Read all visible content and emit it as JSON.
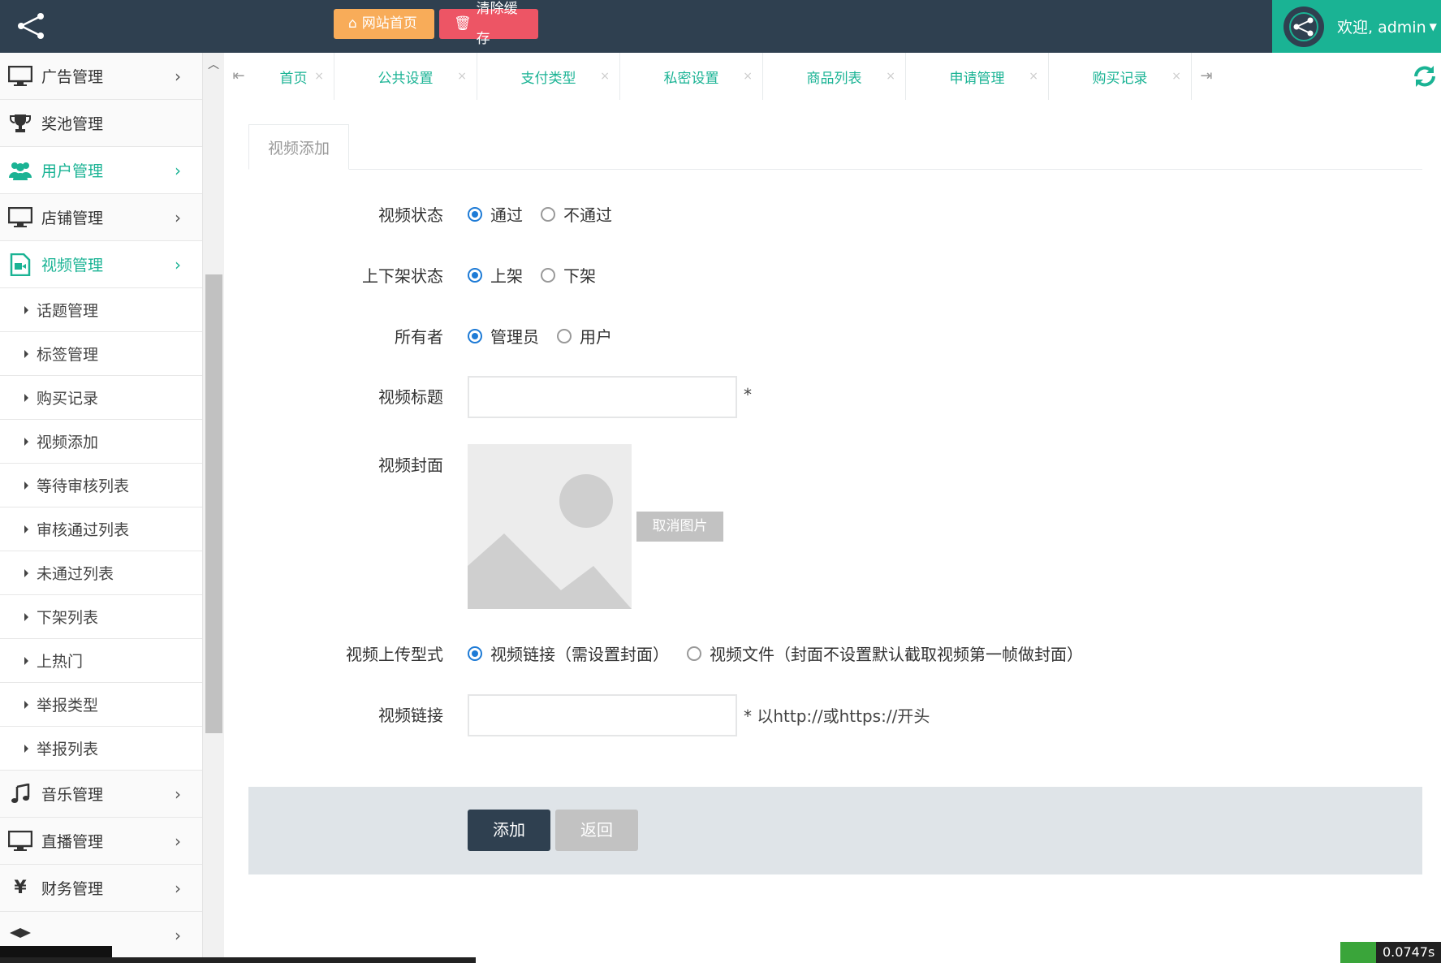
{
  "header": {
    "home_button": "网站首页",
    "clear_cache_button": "清除缓存",
    "welcome": "欢迎, admin"
  },
  "sidebar": {
    "items": [
      {
        "label": "广告管理",
        "icon": "monitor-icon"
      },
      {
        "label": "奖池管理",
        "icon": "trophy-icon"
      },
      {
        "label": "用户管理",
        "icon": "users-icon"
      },
      {
        "label": "店铺管理",
        "icon": "monitor-icon"
      },
      {
        "label": "视频管理",
        "icon": "video-file-icon"
      },
      {
        "label": "音乐管理",
        "icon": "music-icon"
      },
      {
        "label": "直播管理",
        "icon": "monitor-icon"
      },
      {
        "label": "财务管理",
        "icon": "yen-icon"
      }
    ],
    "sub_items": [
      "话题管理",
      "标签管理",
      "购买记录",
      "视频添加",
      "等待审核列表",
      "审核通过列表",
      "未通过列表",
      "下架列表",
      "上热门",
      "举报类型",
      "举报列表"
    ]
  },
  "tabs": [
    "首页",
    "公共设置",
    "支付类型",
    "私密设置",
    "商品列表",
    "申请管理",
    "购买记录"
  ],
  "form": {
    "tab_title": "视频添加",
    "status_label": "视频状态",
    "status_options": [
      "通过",
      "不通过"
    ],
    "shelf_label": "上下架状态",
    "shelf_options": [
      "上架",
      "下架"
    ],
    "owner_label": "所有者",
    "owner_options": [
      "管理员",
      "用户"
    ],
    "title_label": "视频标题",
    "title_required": "*",
    "cover_label": "视频封面",
    "cancel_image": "取消图片",
    "upload_type_label": "视频上传型式",
    "upload_options": [
      "视频链接（需设置封面）",
      "视频文件（封面不设置默认截取视频第一帧做封面）"
    ],
    "link_label": "视频链接",
    "link_hint": "* 以http://或https://开头",
    "add_button": "添加",
    "back_button": "返回"
  },
  "timer": "0.0747s",
  "colors": {
    "topbar": "#2f4050",
    "accent": "#1ab394",
    "radio": "#1e7bd6"
  }
}
